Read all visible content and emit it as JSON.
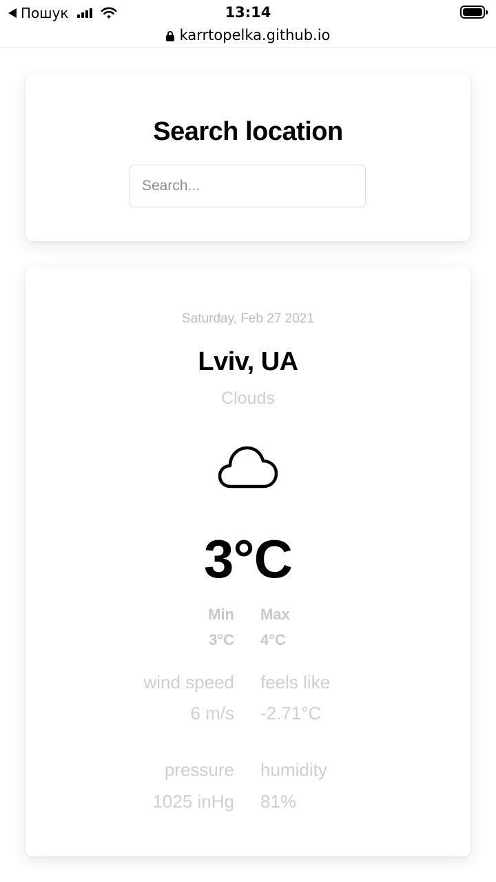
{
  "status_bar": {
    "carrier": "Пошук",
    "time": "13:14"
  },
  "browser": {
    "url": "karrtopelka.github.io"
  },
  "search": {
    "title": "Search location",
    "placeholder": "Search..."
  },
  "weather": {
    "date": "Saturday, Feb 27 2021",
    "city": "Lviv, UA",
    "condition": "Clouds",
    "condition_icon": "cloud-icon",
    "temperature": "3°C",
    "min_label": "Min",
    "min_value": "3°C",
    "max_label": "Max",
    "max_value": "4°C",
    "wind_label": "wind speed",
    "wind_value": "6 m/s",
    "feels_label": "feels like",
    "feels_value": "-2.71°C",
    "pressure_label": "pressure",
    "pressure_value": "1025 inHg",
    "humidity_label": "humidity",
    "humidity_value": "81%"
  }
}
